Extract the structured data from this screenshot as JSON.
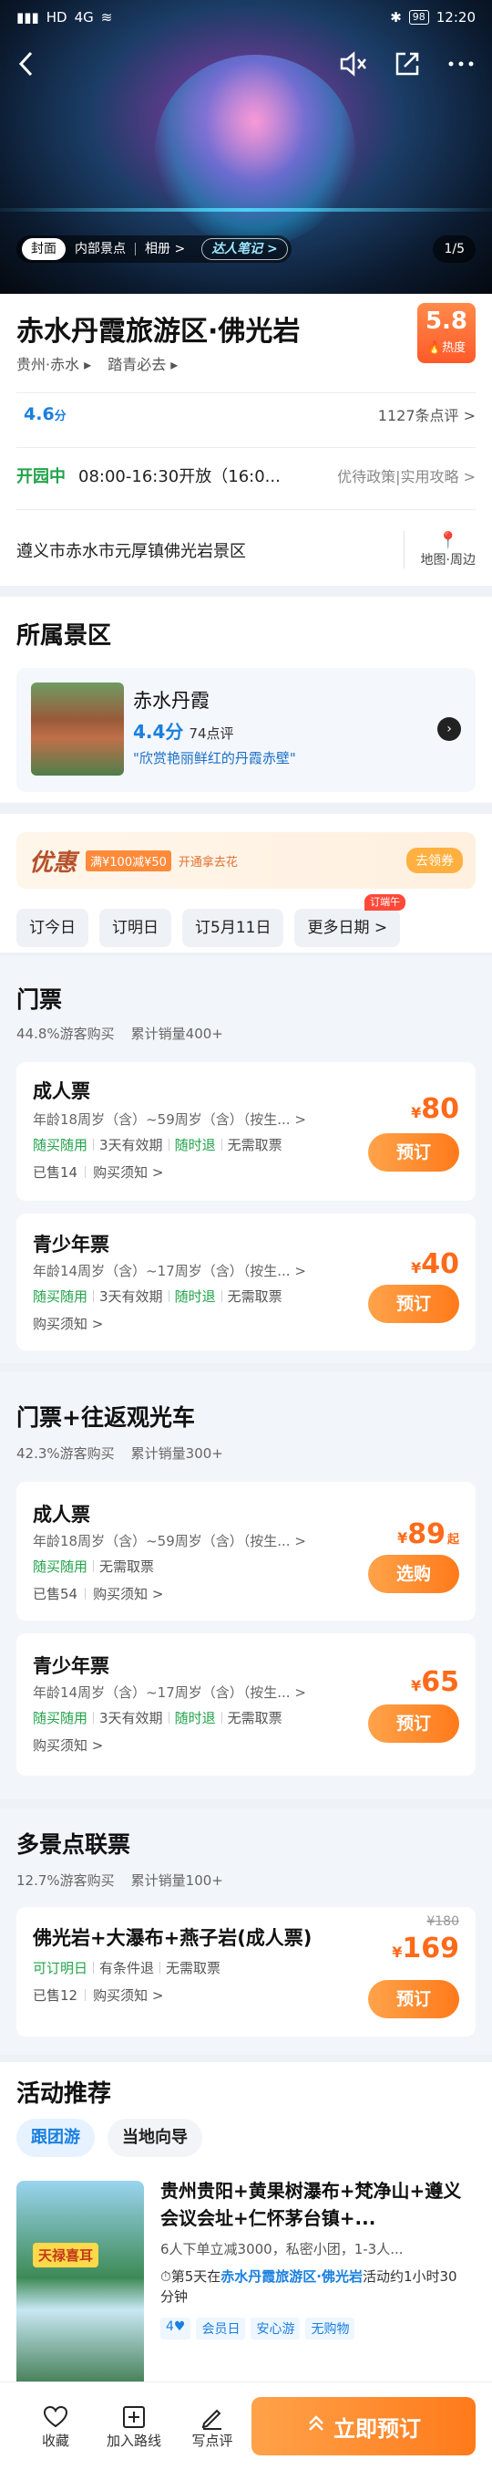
{
  "status": {
    "carrier1": "HD",
    "carrier2": "4G",
    "time": "12:20",
    "battery": "98"
  },
  "hero": {
    "tabs": [
      "封面",
      "内部景点",
      "相册 >"
    ],
    "note": "达人笔记 >",
    "counter": "1/5"
  },
  "poi": {
    "title": "赤水丹霞旅游区·佛光岩",
    "heat_score": "5.8",
    "heat_label": "热度",
    "region": "贵州·赤水 ▸",
    "tag": "踏青必去 ▸",
    "rating": "4.6",
    "rating_unit": "分",
    "reviews": "1127条点评 >",
    "open_status": "开园中",
    "hours": "08:00-16:30开放（16:0...",
    "policy": "优待政策|实用攻略 >",
    "address": "遵义市赤水市元厚镇佛光岩景区",
    "map_label": "地图·周边"
  },
  "scenic": {
    "section_title": "所属景区",
    "name": "赤水丹霞",
    "rating": "4.4分",
    "reviews": "74点评",
    "quote": "\"欣赏艳丽鲜红的丹霞赤壁\""
  },
  "promo": {
    "logo": "优惠",
    "coupon": "满¥100减¥50",
    "slogan": "开通拿去花",
    "button": "去领券"
  },
  "dates": {
    "items": [
      "订今日",
      "订明日",
      "订5月11日",
      "更多日期 >"
    ],
    "tag": "订端午"
  },
  "groups": [
    {
      "title": "门票",
      "stats": [
        "44.8%游客购买",
        "累计销量400+"
      ],
      "tickets": [
        {
          "name": "成人票",
          "age": "年龄18周岁（含）~59周岁（含）（按生...   >",
          "tags": [
            "随买随用",
            "3天有效期",
            "随时退",
            "无需取票"
          ],
          "meta": [
            "已售14",
            "购买须知 >"
          ],
          "price": "80",
          "currency": "¥",
          "button": "预订"
        },
        {
          "name": "青少年票",
          "age": "年龄14周岁（含）~17周岁（含）（按生...   >",
          "tags": [
            "随买随用",
            "3天有效期",
            "随时退",
            "无需取票"
          ],
          "meta": [
            "购买须知 >"
          ],
          "price": "40",
          "currency": "¥",
          "button": "预订"
        }
      ]
    },
    {
      "title": "门票+往返观光车",
      "stats": [
        "42.3%游客购买",
        "累计销量300+"
      ],
      "tickets": [
        {
          "name": "成人票",
          "age": "年龄18周岁（含）~59周岁（含）（按生...   >",
          "tags": [
            "随买随用",
            "无需取票"
          ],
          "meta": [
            "已售54",
            "购买须知 >"
          ],
          "price": "89",
          "currency": "¥",
          "suffix": "起",
          "button": "选购"
        },
        {
          "name": "青少年票",
          "age": "年龄14周岁（含）~17周岁（含）（按生...   >",
          "tags": [
            "随买随用",
            "3天有效期",
            "随时退",
            "无需取票"
          ],
          "meta": [
            "购买须知 >"
          ],
          "price": "65",
          "currency": "¥",
          "button": "预订"
        }
      ]
    },
    {
      "title": "多景点联票",
      "stats": [
        "12.7%游客购买",
        "累计销量100+"
      ],
      "tickets": [
        {
          "name": "佛光岩+大瀑布+燕子岩(成人票)",
          "tags": [
            "可订明日",
            "有条件退",
            "无需取票"
          ],
          "meta": [
            "已售12",
            "购买须知 >"
          ],
          "orig": "¥180",
          "price": "169",
          "currency": "¥",
          "button": "预订"
        }
      ]
    }
  ],
  "activity": {
    "section_title": "活动推荐",
    "tabs": [
      "跟团游",
      "当地向导"
    ],
    "card": {
      "badge": "天禄喜耳",
      "title": "贵州贵阳+黄果树瀑布+梵净山+遵义会议会址+仁怀茅台镇+...",
      "desc": "6人下单立减3000，私密小团，1-3人...",
      "day_prefix": "第5天在",
      "day_place": "赤水丹霞旅游区·佛光岩",
      "day_suffix": "活动约1小时30分钟",
      "badges": [
        "4♥",
        "会员日",
        "安心游",
        "无购物"
      ]
    }
  },
  "bottom": {
    "items": [
      "收藏",
      "加入路线",
      "写点评"
    ],
    "cta": "立即预订"
  },
  "colors": {
    "accent": "#1a7fe0",
    "orange": "#ff7a1a",
    "green": "#22a34a"
  }
}
